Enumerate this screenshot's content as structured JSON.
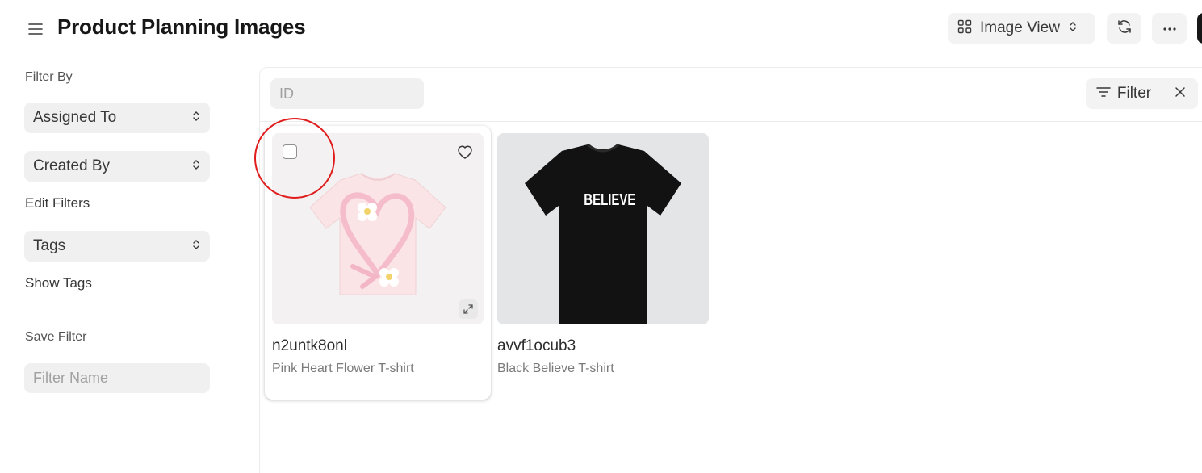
{
  "header": {
    "title": "Product Planning Images",
    "view_label": "Image View"
  },
  "sidebar": {
    "filter_by_label": "Filter By",
    "assigned_to": "Assigned To",
    "created_by": "Created By",
    "edit_filters": "Edit Filters",
    "tags": "Tags",
    "show_tags": "Show Tags",
    "save_filter_label": "Save Filter",
    "filter_name_placeholder": "Filter Name"
  },
  "filterbar": {
    "id_placeholder": "ID",
    "filter_label": "Filter"
  },
  "cards": [
    {
      "name": "n2untk8onl",
      "description": "Pink Heart Flower T-shirt",
      "tshirt_color": "#fbe4e6"
    },
    {
      "name": "avvf1ocub3",
      "description": "Black Believe T-shirt",
      "tshirt_color": "#111111",
      "print_text": "BELIEVE"
    }
  ],
  "colors": {
    "annotation_circle": "#e01c1c"
  }
}
